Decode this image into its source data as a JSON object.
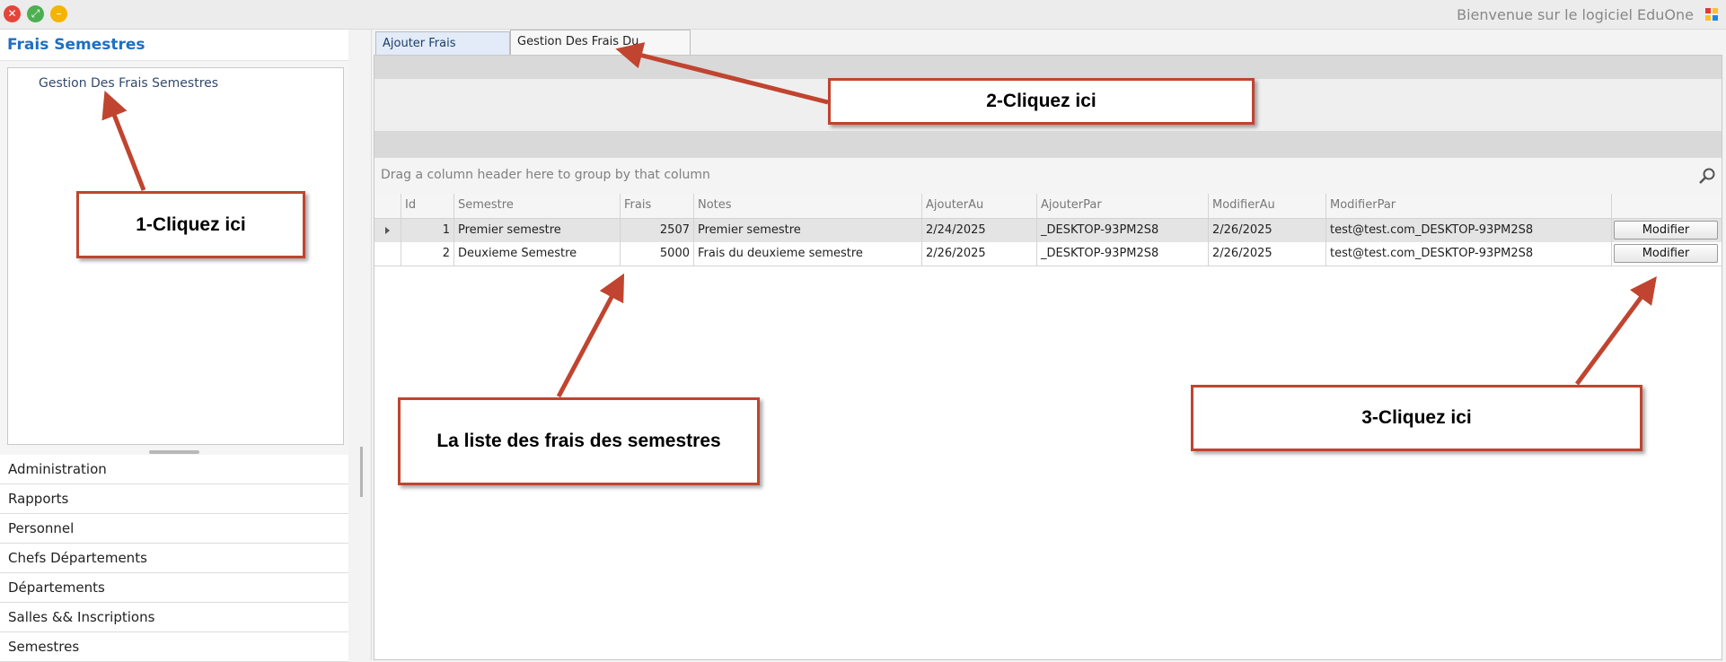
{
  "window": {
    "welcome_text": "Bienvenue sur le logiciel EduOne"
  },
  "sidebar": {
    "title": "Frais Semestres",
    "tree_item": "Gestion Des Frais Semestres",
    "nav_items": [
      "Administration",
      "Rapports",
      "Personnel",
      "Chefs Départements",
      "Départements",
      "Salles && Inscriptions",
      "Semestres"
    ]
  },
  "tabs": [
    {
      "label": "Ajouter Frais Semestre"
    },
    {
      "label": "Gestion Des Frais Du Semestre"
    }
  ],
  "grid": {
    "group_hint": "Drag a column header here to group by that column",
    "columns": [
      "Id",
      "Semestre",
      "Frais",
      "Notes",
      "AjouterAu",
      "AjouterPar",
      "ModifierAu",
      "ModifierPar"
    ],
    "rows": [
      {
        "id": "1",
        "semestre": "Premier semestre",
        "frais": "2507",
        "notes": "Premier semestre",
        "ajouter_au": "2/24/2025",
        "ajouter_par": "_DESKTOP-93PM2S8",
        "modifier_au": "2/26/2025",
        "modifier_par": "test@test.com_DESKTOP-93PM2S8",
        "action": "Modifier"
      },
      {
        "id": "2",
        "semestre": "Deuxieme Semestre",
        "frais": "5000",
        "notes": "Frais du deuxieme semestre",
        "ajouter_au": "2/26/2025",
        "ajouter_par": "_DESKTOP-93PM2S8",
        "modifier_au": "2/26/2025",
        "modifier_par": "test@test.com_DESKTOP-93PM2S8",
        "action": "Modifier"
      }
    ]
  },
  "callouts": {
    "step1": "1-Cliquez ici",
    "step2": "2-Cliquez ici",
    "step3": "3-Cliquez ici",
    "list": "La liste des frais des semestres"
  },
  "colors": {
    "accent": "#1e6fc2",
    "callout_border": "#c0442f",
    "close": "#e5443a",
    "maximize": "#4caf50",
    "minimize": "#f4b400"
  }
}
